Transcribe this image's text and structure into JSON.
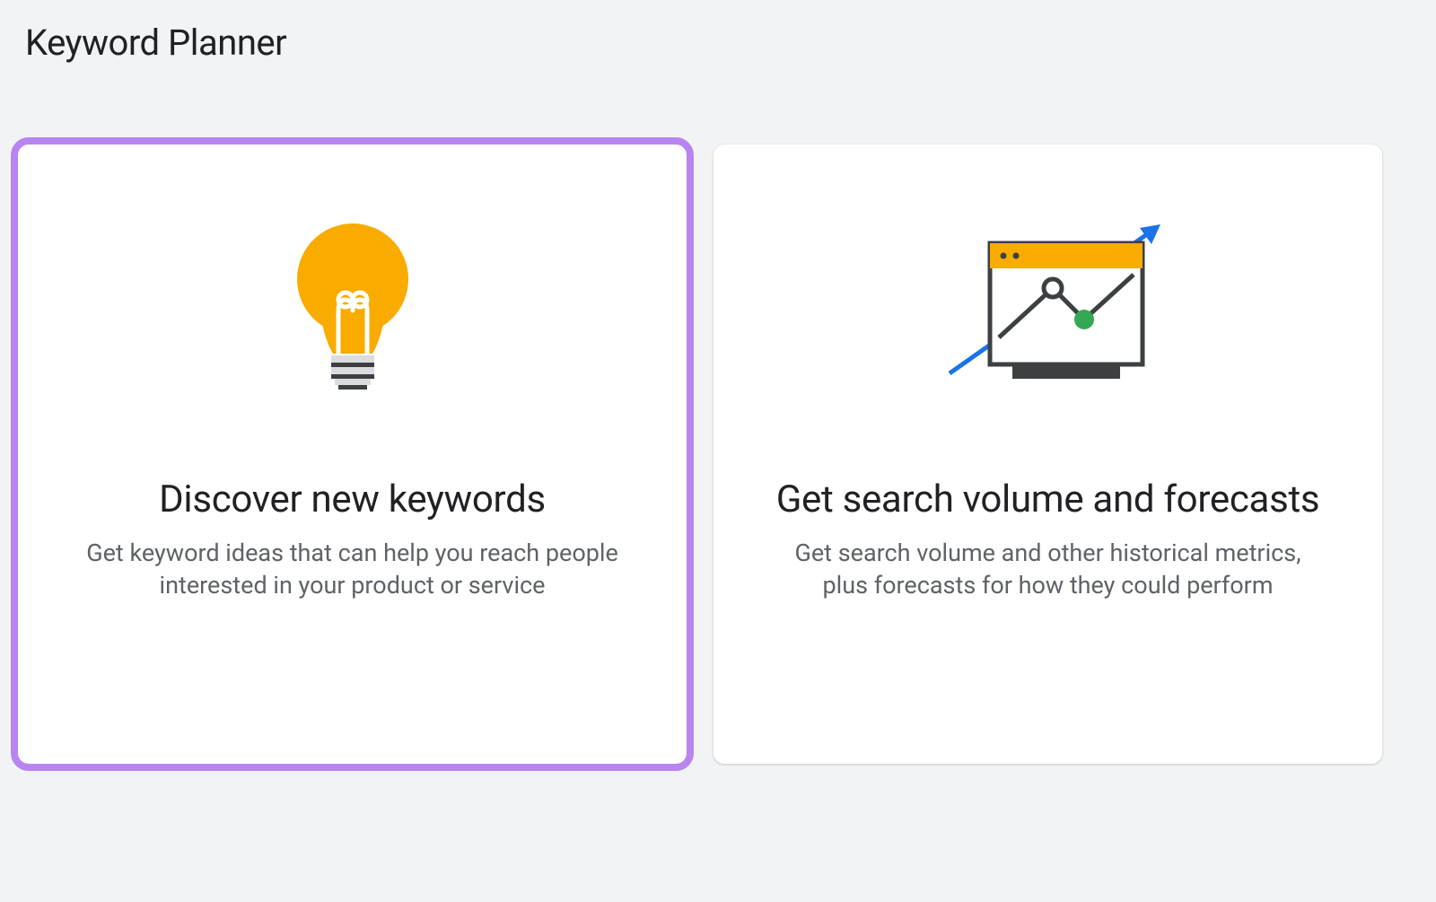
{
  "page": {
    "title": "Keyword Planner"
  },
  "cards": [
    {
      "title": "Discover new keywords",
      "description": "Get keyword ideas that can help you reach people interested in your product or service",
      "highlighted": true
    },
    {
      "title": "Get search volume and forecasts",
      "description": "Get search volume and other historical metrics, plus forecasts for how they could perform",
      "highlighted": false
    }
  ]
}
